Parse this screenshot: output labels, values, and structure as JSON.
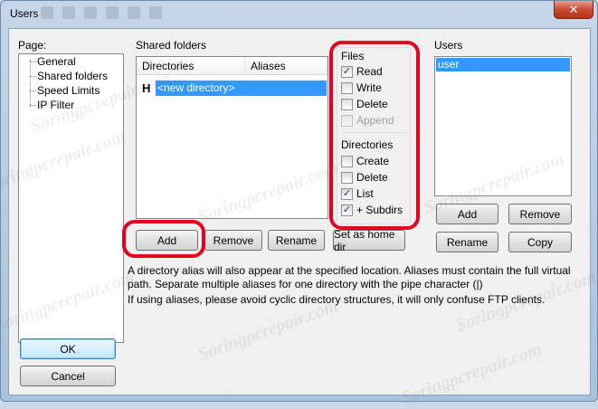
{
  "window": {
    "title": "Users",
    "close_glyph": "✕"
  },
  "page_section": {
    "label": "Page:",
    "items": [
      "General",
      "Shared folders",
      "Speed Limits",
      "IP Filter"
    ]
  },
  "shared_folders": {
    "label": "Shared folders",
    "columns": [
      "Directories",
      "Aliases"
    ],
    "rows": [
      {
        "home_marker": "H",
        "directory": "<new directory>",
        "alias": ""
      }
    ],
    "buttons": {
      "add": "Add",
      "remove": "Remove",
      "rename": "Rename",
      "set_home": "Set as home dir"
    }
  },
  "permissions": {
    "files_label": "Files",
    "files": [
      {
        "label": "Read",
        "checked": true,
        "disabled": false
      },
      {
        "label": "Write",
        "checked": false,
        "disabled": false
      },
      {
        "label": "Delete",
        "checked": false,
        "disabled": false
      },
      {
        "label": "Append",
        "checked": false,
        "disabled": true
      }
    ],
    "directories_label": "Directories",
    "directories": [
      {
        "label": "Create",
        "checked": false,
        "disabled": false
      },
      {
        "label": "Delete",
        "checked": false,
        "disabled": false
      },
      {
        "label": "List",
        "checked": true,
        "disabled": false
      },
      {
        "label": "+ Subdirs",
        "checked": true,
        "disabled": false
      }
    ]
  },
  "users_section": {
    "label": "Users",
    "items": [
      "user"
    ],
    "buttons": {
      "add": "Add",
      "remove": "Remove",
      "rename": "Rename",
      "copy": "Copy"
    }
  },
  "info_text": {
    "line1": "A directory alias will also appear at the specified location. Aliases must contain the full virtual",
    "line2": "path. Separate multiple aliases for one directory with the pipe character (|)",
    "line3": "If using aliases, please avoid cyclic directory structures, it will only confuse FTP clients."
  },
  "dialog_buttons": {
    "ok": "OK",
    "cancel": "Cancel"
  },
  "watermark_text": "Soringpcrepair.com",
  "colors": {
    "selection": "#3399ff",
    "annotation_ring": "#e6001e",
    "close_button": "#c84a32"
  }
}
